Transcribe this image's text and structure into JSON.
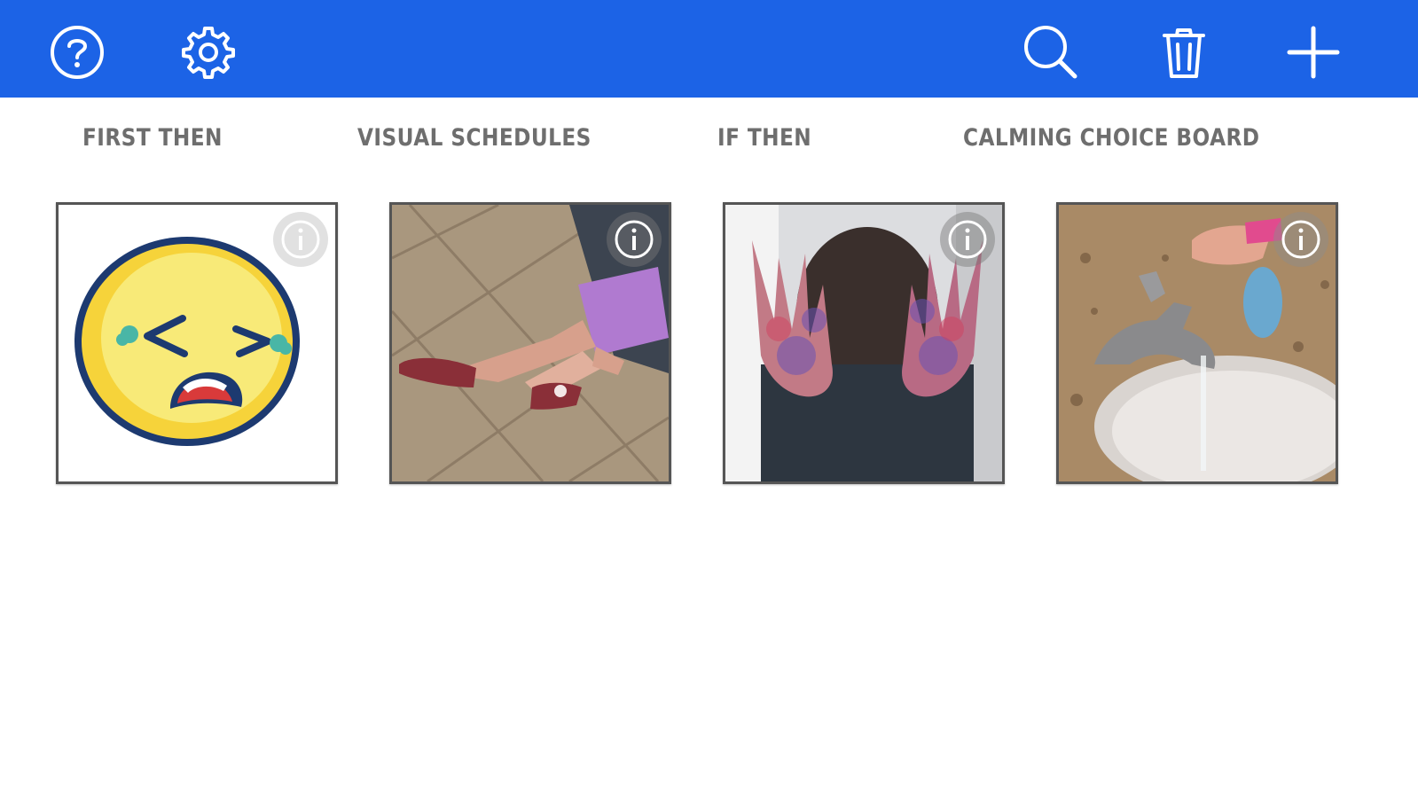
{
  "colors": {
    "topbar": "#1c63e6",
    "tab_text": "#6e6e6e",
    "card_border": "#555555"
  },
  "toolbar": {
    "left": [
      {
        "icon": "help-icon"
      },
      {
        "icon": "gear-icon"
      }
    ],
    "right": [
      {
        "icon": "search-icon"
      },
      {
        "icon": "trash-icon"
      },
      {
        "icon": "plus-icon"
      }
    ]
  },
  "tabs": [
    {
      "label": "FIRST THEN"
    },
    {
      "label": "VISUAL SCHEDULES"
    },
    {
      "label": "IF THEN"
    },
    {
      "label": "CALMING CHOICE BOARD"
    }
  ],
  "cards": [
    {
      "image": "crying-face-emoji",
      "info_icon": "info-icon"
    },
    {
      "image": "child-sitting-on-tile-floor",
      "info_icon": "info-icon"
    },
    {
      "image": "child-painted-hands",
      "info_icon": "info-icon"
    },
    {
      "image": "washing-hands-at-sink",
      "info_icon": "info-icon"
    }
  ]
}
